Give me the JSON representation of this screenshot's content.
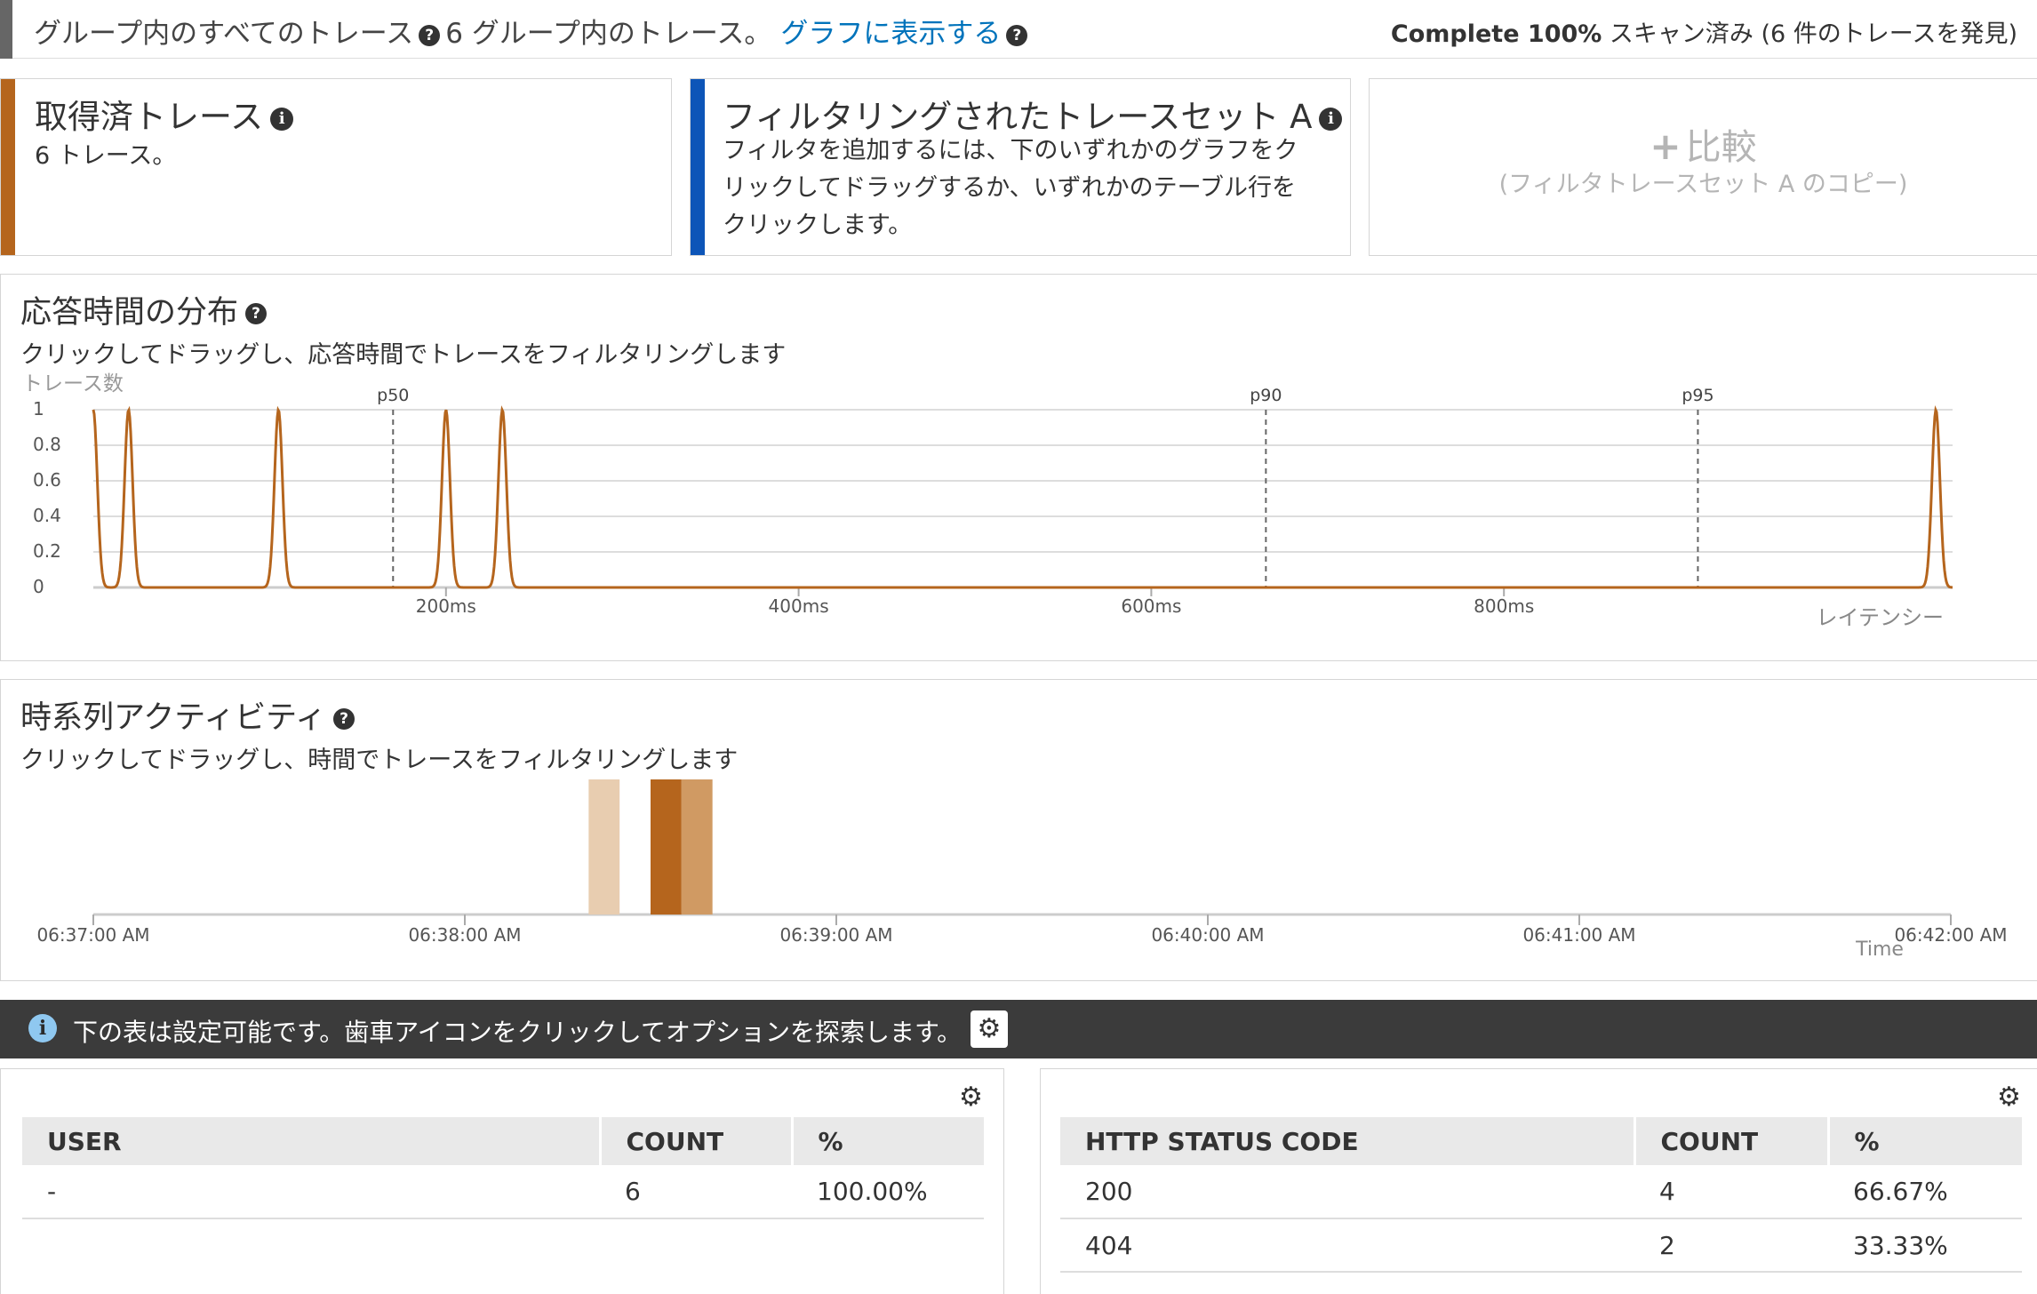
{
  "top": {
    "title": "グループ内のすべてのトレース",
    "count_text": "6 グループ内のトレース。",
    "graph_link": "グラフに表示する",
    "status_bold": "Complete 100%",
    "status_rest": " スキャン済み (6 件のトレースを発見)"
  },
  "cards": {
    "retrieved": {
      "title": "取得済トレース",
      "subtitle": "6 トレース。",
      "accent": "#b5651d"
    },
    "filtered": {
      "title": "フィルタリングされたトレースセット A",
      "line1": "フィルタを追加するには、下のいずれかのグラフをク",
      "line2": "リックしてドラッグするか、いずれかのテーブル行を",
      "line3": "クリックします。",
      "accent": "#0d55b8"
    },
    "compare": {
      "label": "比較",
      "copy": "(フィルタトレースセット A のコピー)"
    }
  },
  "response": {
    "title": "応答時間の分布",
    "subtitle": "クリックしてドラッグし、応答時間でトレースをフィルタリングします",
    "chart_data": {
      "type": "line",
      "ylabel": "トレース数",
      "xlabel": "レイテンシー",
      "y_ticks": [
        "0",
        "0.2",
        "0.4",
        "0.6",
        "0.8",
        "1"
      ],
      "x_ticks": [
        "200ms",
        "400ms",
        "600ms",
        "800ms"
      ],
      "percentiles": [
        {
          "label": "p50",
          "value_ms": 170
        },
        {
          "label": "p90",
          "value_ms": 665
        },
        {
          "label": "p95",
          "value_ms": 910
        }
      ],
      "peaks_ms": [
        0,
        20,
        105,
        200,
        232,
        1045
      ],
      "ylim": [
        0,
        1
      ],
      "color": "#b5651d"
    }
  },
  "timeline": {
    "title": "時系列アクティビティ",
    "subtitle": "クリックしてドラッグし、時間でトレースをフィルタリングします",
    "chart_data": {
      "type": "bar",
      "x_ticks": [
        "06:37:00 AM",
        "06:38:00 AM",
        "06:39:00 AM",
        "06:40:00 AM",
        "06:41:00 AM",
        "06:42:00 AM"
      ],
      "xlabel": "Time",
      "bars": [
        {
          "start": "06:38:20 AM",
          "end": "06:38:25 AM",
          "count": 1,
          "color": "#e8cdb0"
        },
        {
          "start": "06:38:30 AM",
          "end": "06:38:35 AM",
          "count": 3,
          "color": "#b5651d"
        },
        {
          "start": "06:38:35 AM",
          "end": "06:38:40 AM",
          "count": 2,
          "color": "#d09a63"
        }
      ]
    }
  },
  "banner": {
    "text": "下の表は設定可能です。歯車アイコンをクリックしてオプションを探索します。"
  },
  "user_table": {
    "headers": [
      "USER",
      "COUNT",
      "%"
    ],
    "rows": [
      [
        "-",
        "6",
        "100.00%"
      ]
    ]
  },
  "status_table": {
    "headers": [
      "HTTP STATUS CODE",
      "COUNT",
      "%"
    ],
    "rows": [
      [
        "200",
        "4",
        "66.67%"
      ],
      [
        "404",
        "2",
        "33.33%"
      ]
    ]
  }
}
